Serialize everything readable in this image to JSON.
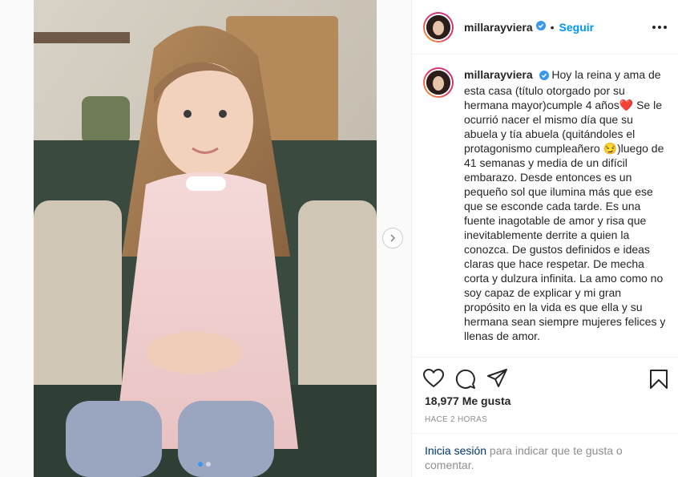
{
  "post": {
    "username": "millarayviera",
    "follow_label": "Seguir",
    "separator": "•",
    "caption": "Hoy la reina y ama de esta casa (título otorgado por su hermana mayor)cumple 4 años❤️ Se le ocurrió nacer el mismo día que su abuela y tía abuela (quitándoles el protagonismo cumpleañero 😏)luego de 41 semanas y media de un difícil embarazo. Desde entonces es un pequeño sol que ilumina más que ese que se esconde cada tarde. Es una fuente inagotable de amor y risa que inevitablemente derrite a quien la conozca. De gustos definidos e ideas claras que hace respetar. De mecha corta y dulzura infinita. La amo como no soy capaz de explicar y mi gran propósito en la vida es que ella y su hermana sean siempre mujeres felices y llenas de amor.",
    "likes": "18,977 Me gusta",
    "time": "HACE 2 HORAS",
    "login_link": "Inicia sesión",
    "login_rest": " para indicar que te gusta o comentar."
  },
  "carousel": {
    "slides": 2,
    "current": 1
  },
  "icons": {
    "verified": "verified-badge-icon",
    "more": "more-options-icon",
    "like": "heart-icon",
    "comment": "comment-icon",
    "share": "share-icon",
    "save": "bookmark-icon",
    "next": "chevron-right-icon"
  },
  "colors": {
    "link": "#0095f6",
    "verified": "#3897f0",
    "text": "#262626",
    "muted": "#8e8e8e"
  }
}
